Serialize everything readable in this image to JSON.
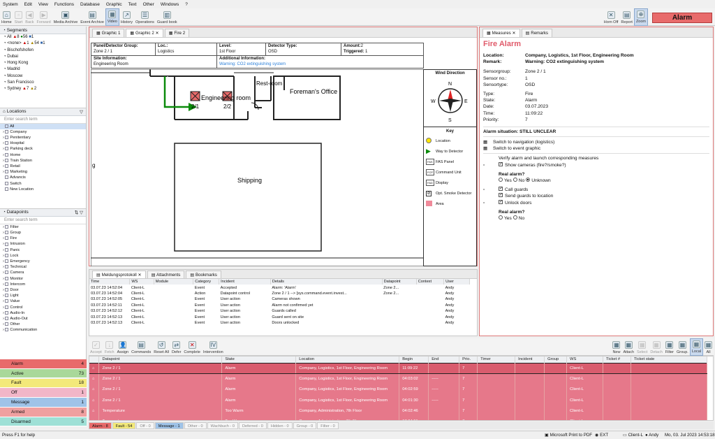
{
  "menu": [
    "System",
    "Edit",
    "View",
    "Functions",
    "Database",
    "Graphic",
    "Text",
    "Other",
    "Windows",
    "?"
  ],
  "toolbar": {
    "left": [
      "Home",
      "Start",
      "Back",
      "Forward",
      "Media Archive",
      "Event Archive",
      "Video",
      "History",
      "Operations",
      "Guard book"
    ],
    "right": [
      "Horn Off",
      "Report",
      "Zoom"
    ],
    "alarm": "Alarm"
  },
  "segments": {
    "title": "Segments",
    "all": "All",
    "all_counts": [
      "8",
      "56",
      "1"
    ],
    "none": "<none>",
    "none_counts": [
      "1",
      "54",
      "1"
    ],
    "items": [
      "Bischofshofen",
      "Dubai",
      "Hong Kong",
      "Madrid",
      "Moscow",
      "San Francisco",
      "Sydney"
    ],
    "sydney_counts": [
      "7",
      "2"
    ]
  },
  "locations": {
    "title": "Locations",
    "placeholder": "Enter search term",
    "items": [
      "All",
      "Company",
      "Penitentiary",
      "Hospital",
      "Parking deck",
      "Home",
      "Train Station",
      "Retail",
      "Marketing",
      "Advancis",
      "Switch",
      "New Location"
    ]
  },
  "datapoints": {
    "title": "Datapoints",
    "placeholder": "Enter search term",
    "items": [
      "Filter",
      "Group",
      "Fire",
      "Intrusion",
      "Panic",
      "Lock",
      "Emergency",
      "Technical",
      "Camera",
      "Monitor",
      "Intercom",
      "Door",
      "Light",
      "Value",
      "Control",
      "Audio-In",
      "Audio-Out",
      "Other",
      "Communication"
    ]
  },
  "status": [
    {
      "label": "Alarm",
      "count": "4",
      "color": "#e86b6b"
    },
    {
      "label": "Active",
      "count": "73",
      "color": "#a9d89a"
    },
    {
      "label": "Fault",
      "count": "18",
      "color": "#f3e97a"
    },
    {
      "label": "Off",
      "count": "1",
      "color": "#f2b6c8"
    },
    {
      "label": "Message",
      "count": "1",
      "color": "#9fc3e8"
    },
    {
      "label": "Armed",
      "count": "8",
      "color": "#f0a0a0"
    },
    {
      "label": "Disarmed",
      "count": "5",
      "color": "#9ee0d6"
    }
  ],
  "graphic_tabs": [
    "Graphic 1",
    "Graphic 2",
    "Fire 2"
  ],
  "info": {
    "panel_label": "Panel/Detector Group:",
    "panel": "Zone 2 / 1",
    "loc_label": "Loc.:",
    "loc": "Logistics",
    "level_label": "Level:",
    "level": "1st Floor",
    "det_label": "Detector Type:",
    "det": "OSD",
    "amount_label": "Amount:",
    "amount": "2",
    "trig_label": "Triggered:",
    "trig": "1",
    "site_label": "Site Information:",
    "site": "Engineering Room",
    "add_label": "Additional Information:",
    "add": "Warning: CO2 extinguishing system"
  },
  "floor": {
    "rooms": [
      "Engineering room",
      "Rest-room",
      "Foreman's Office",
      "Shipping"
    ],
    "detectors": [
      "2/1",
      "2/2"
    ],
    "cut": "g"
  },
  "compass": {
    "title": "Wind Direction",
    "n": "N",
    "e": "E",
    "s": "S",
    "w": "W"
  },
  "key": {
    "title": "Key",
    "items": [
      "Location",
      "Way to Detector",
      "FAS Panel",
      "Command Unit",
      "Display",
      "Opt. Smoke Detector",
      "Area"
    ],
    "badges": [
      "FAS",
      "FCP",
      "FAD"
    ]
  },
  "log": {
    "tabs": [
      "Meldungsprotokoll",
      "Attachments",
      "Bookmarks"
    ],
    "cols": [
      "Time",
      "WS",
      "Module",
      "Category",
      "Incident",
      "Details",
      "Datapoint",
      "Context",
      "User"
    ],
    "rows": [
      [
        "03.07.23",
        "14:52:04",
        "Client-L",
        "",
        "Event",
        "Accepted",
        "Alarm: 'Alarm'",
        "Zone 2...",
        "",
        "Andy"
      ],
      [
        "03.07.23",
        "14:52:04",
        "Client-L",
        "",
        "Action",
        "Datapoint control",
        "Zone 2 / 1 --> [sys.command.event.invest...",
        "Zone 2...",
        "",
        "Andy"
      ],
      [
        "03.07.23",
        "14:52:05",
        "Client-L",
        "",
        "Event",
        "User action",
        "Cameras shown",
        "",
        "",
        "Andy"
      ],
      [
        "03.07.23",
        "14:52:11",
        "Client-L",
        "",
        "Event",
        "User action",
        "Alarm not confirmed yet",
        "",
        "",
        "Andy"
      ],
      [
        "03.07.23",
        "14:52:12",
        "Client-L",
        "",
        "Event",
        "User action",
        "Guards called",
        "",
        "",
        "Andy"
      ],
      [
        "03.07.23",
        "14:52:13",
        "Client-L",
        "",
        "Event",
        "User action",
        "Guard sent on site",
        "",
        "",
        "Andy"
      ],
      [
        "03.07.23",
        "14:52:13",
        "Client-L",
        "",
        "Event",
        "User action",
        "Doors unlocked",
        "",
        "",
        "Andy"
      ]
    ]
  },
  "measures": {
    "tabs": [
      "Measures",
      "Remarks"
    ],
    "title": "Fire Alarm",
    "location_label": "Location:",
    "location": "Company, Logistics, 1st Floor, Engineering Room",
    "remark_label": "Remark:",
    "remark": "Warning: CO2 extinguishing system",
    "details": [
      [
        "Sensorgroup:",
        "Zone 2 / 1"
      ],
      [
        "Sensor no.:",
        "1"
      ],
      [
        "Sensortype:",
        "OSD"
      ]
    ],
    "details2": [
      [
        "Type:",
        "Fire"
      ],
      [
        "State:",
        "Alarm"
      ],
      [
        "Date:",
        "03.07.2023"
      ],
      [
        "Time:",
        "11:09:22"
      ],
      [
        "Priority:",
        "7"
      ]
    ],
    "situation": "Alarm situation:   STILL UNCLEAR",
    "nav": "Switch to navigation (logistics)",
    "evt": "Switch to event graphic",
    "verify": "Verify alarm and launch corresponding measures",
    "cams": "Show cameras (fire?/smoke?)",
    "real1": "Real alarm?",
    "yes": "Yes",
    "no": "No",
    "unknown": "Unknown",
    "call": "Call guards",
    "send": "Send guards to location",
    "unlock": "Unlock doors",
    "real2": "Real alarm?"
  },
  "actions": {
    "left": [
      "Accept",
      "Fetch",
      "Assign",
      "Commands",
      "Reset All",
      "Defer",
      "Complete",
      "Intervention"
    ],
    "right": [
      "New",
      "Attach",
      "Select",
      "Detach",
      "Filter",
      "Group.",
      "Local",
      "All"
    ]
  },
  "grid": {
    "cols": [
      "Datapoint",
      "State",
      "Location",
      "Begin",
      "End",
      "Prio.",
      "Timer",
      "Incident",
      "Group",
      "WS",
      "Ticket #",
      "Ticket state"
    ],
    "rows": [
      [
        "Zone 2 / 1",
        "Alarm",
        "Company, Logistics, 1st Floor, Engineering Room",
        "11:09:22",
        "",
        "7",
        "",
        "",
        "",
        "Client-L",
        "",
        ""
      ],
      [
        "Zone 2 / 1",
        "Alarm",
        "Company, Logistics, 1st Floor, Engineering Room",
        "04:03:02",
        "-----",
        "7",
        "",
        "",
        "",
        "Client-L",
        "",
        ""
      ],
      [
        "Zone 2 / 1",
        "Alarm",
        "Company, Logistics, 1st Floor, Engineering Room",
        "04:02:59",
        "-----",
        "7",
        "",
        "",
        "",
        "Client-L",
        "",
        ""
      ],
      [
        "Zone 2 / 1",
        "Alarm",
        "Company, Logistics, 1st Floor, Engineering Room",
        "04:01:30",
        "-----",
        "7",
        "",
        "",
        "",
        "Client-L",
        "",
        ""
      ],
      [
        "Temperature",
        "Too Warm",
        "Company, Administration, 7th Floor",
        "04:02:46",
        "",
        "7",
        "",
        "",
        "",
        "Client-L",
        "",
        ""
      ],
      [
        "Temperature",
        "Too Warm",
        "Company, Administration, 7th Floor",
        "17:04:51",
        "-----",
        "7",
        "",
        "",
        "",
        "Client-L",
        "",
        ""
      ]
    ]
  },
  "filters": [
    "Alarm - 8",
    "Fault - 54",
    "Off - 0",
    "Message - 1",
    "Other - 0",
    "Wachbuch - 0",
    "Deferred - 0",
    "Hidden - 0",
    "Group - 0",
    "Filter - 0"
  ],
  "statusbar": {
    "help": "Press F1 for help",
    "printer": "Microsoft Print to PDF",
    "ext": "EXT",
    "client": "Client-L",
    "user": "Andy",
    "datetime": "Mo, 03. Jul 2023   14:53:18"
  }
}
